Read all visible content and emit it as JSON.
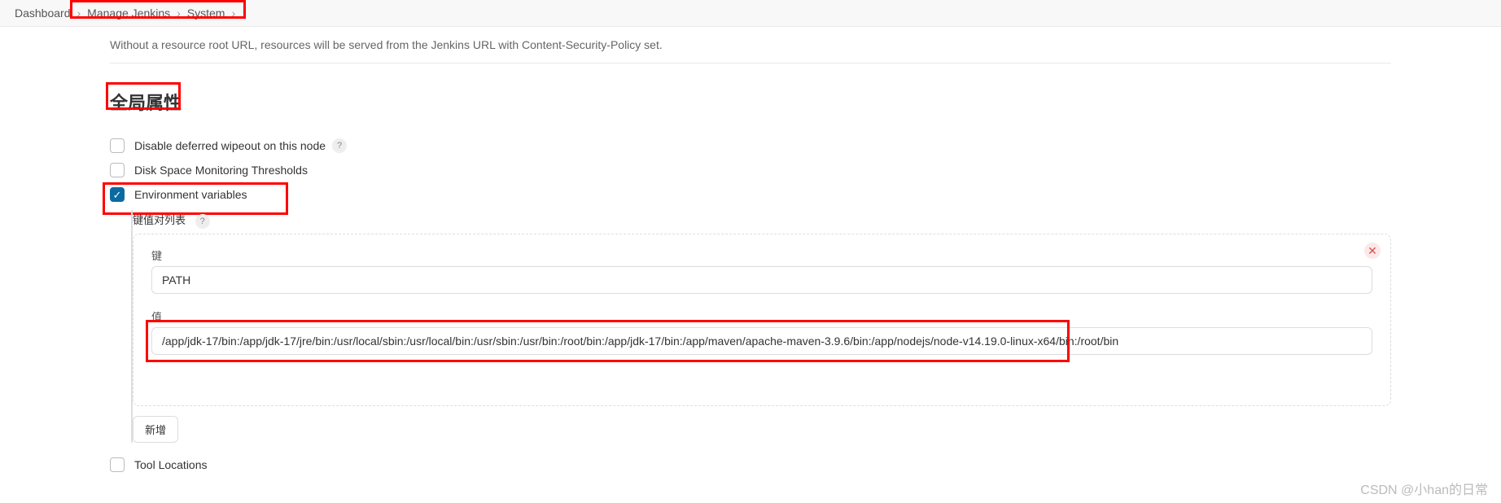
{
  "breadcrumb": {
    "items": [
      "Dashboard",
      "Manage Jenkins",
      "System"
    ]
  },
  "helpText": "Without a resource root URL, resources will be served from the Jenkins URL with Content-Security-Policy set.",
  "section": {
    "title": "全局属性",
    "checkboxes": {
      "deferred": {
        "label": "Disable deferred wipeout on this node",
        "checked": false,
        "hasHelp": true
      },
      "diskSpace": {
        "label": "Disk Space Monitoring Thresholds",
        "checked": false,
        "hasHelp": false
      },
      "envVars": {
        "label": "Environment variables",
        "checked": true,
        "hasHelp": false
      },
      "toolLoc": {
        "label": "Tool Locations",
        "checked": false,
        "hasHelp": false
      }
    },
    "kvListLabel": "键值对列表",
    "kv": {
      "keyLabel": "键",
      "keyValue": "PATH",
      "valueLabel": "值",
      "valueValue": "/app/jdk-17/bin:/app/jdk-17/jre/bin:/usr/local/sbin:/usr/local/bin:/usr/sbin:/usr/bin:/root/bin:/app/jdk-17/bin:/app/maven/apache-maven-3.9.6/bin:/app/nodejs/node-v14.19.0-linux-x64/bin:/root/bin"
    },
    "addLabel": "新增"
  },
  "watermark": "CSDN @小han的日常"
}
